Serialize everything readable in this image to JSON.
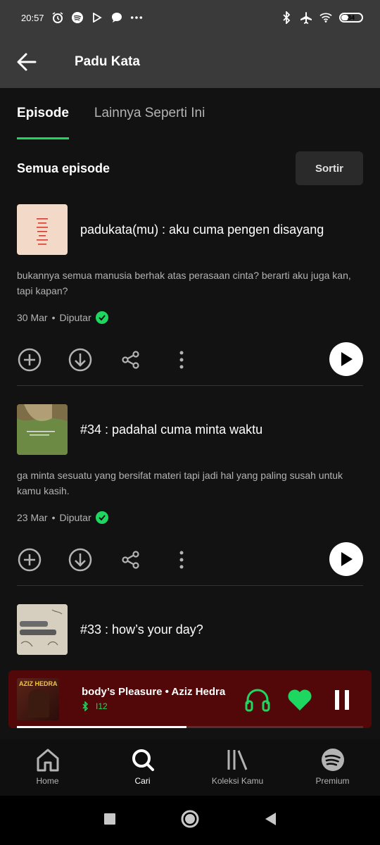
{
  "status_bar": {
    "time": "20:57",
    "battery": "34"
  },
  "header": {
    "title": "Padu Kata"
  },
  "tabs": [
    {
      "label": "Episode",
      "active": true
    },
    {
      "label": "Lainnya Seperti Ini",
      "active": false
    }
  ],
  "section": {
    "title": "Semua episode",
    "sort_label": "Sortir"
  },
  "episodes": [
    {
      "title": "padukata(mu) : aku cuma pengen disayang",
      "description": "bukannya semua manusia berhak atas perasaan cinta? berarti aku juga kan, tapi kapan?",
      "date": "30 Mar",
      "status": "Diputar"
    },
    {
      "title": "#34 : padahal cuma minta waktu",
      "description": "ga minta sesuatu yang bersifat materi tapi jadi hal yang paling susah untuk kamu kasih.",
      "date": "23 Mar",
      "status": "Diputar"
    },
    {
      "title": "#33 : how’s your day?"
    }
  ],
  "mini_player": {
    "art_text": "AZIZ HEDRA",
    "song": "body’s Pleasure • Aziz Hedra",
    "device": "I12",
    "progress": 0.49,
    "color": "#520808"
  },
  "bottom_nav": [
    {
      "label": "Home",
      "icon": "home-icon"
    },
    {
      "label": "Cari",
      "icon": "search-icon",
      "active": true
    },
    {
      "label": "Koleksi Kamu",
      "icon": "library-icon"
    },
    {
      "label": "Premium",
      "icon": "spotify-icon"
    }
  ],
  "colors": {
    "accent": "#1ed760",
    "background": "#121212",
    "header": "#3a3a3a"
  }
}
